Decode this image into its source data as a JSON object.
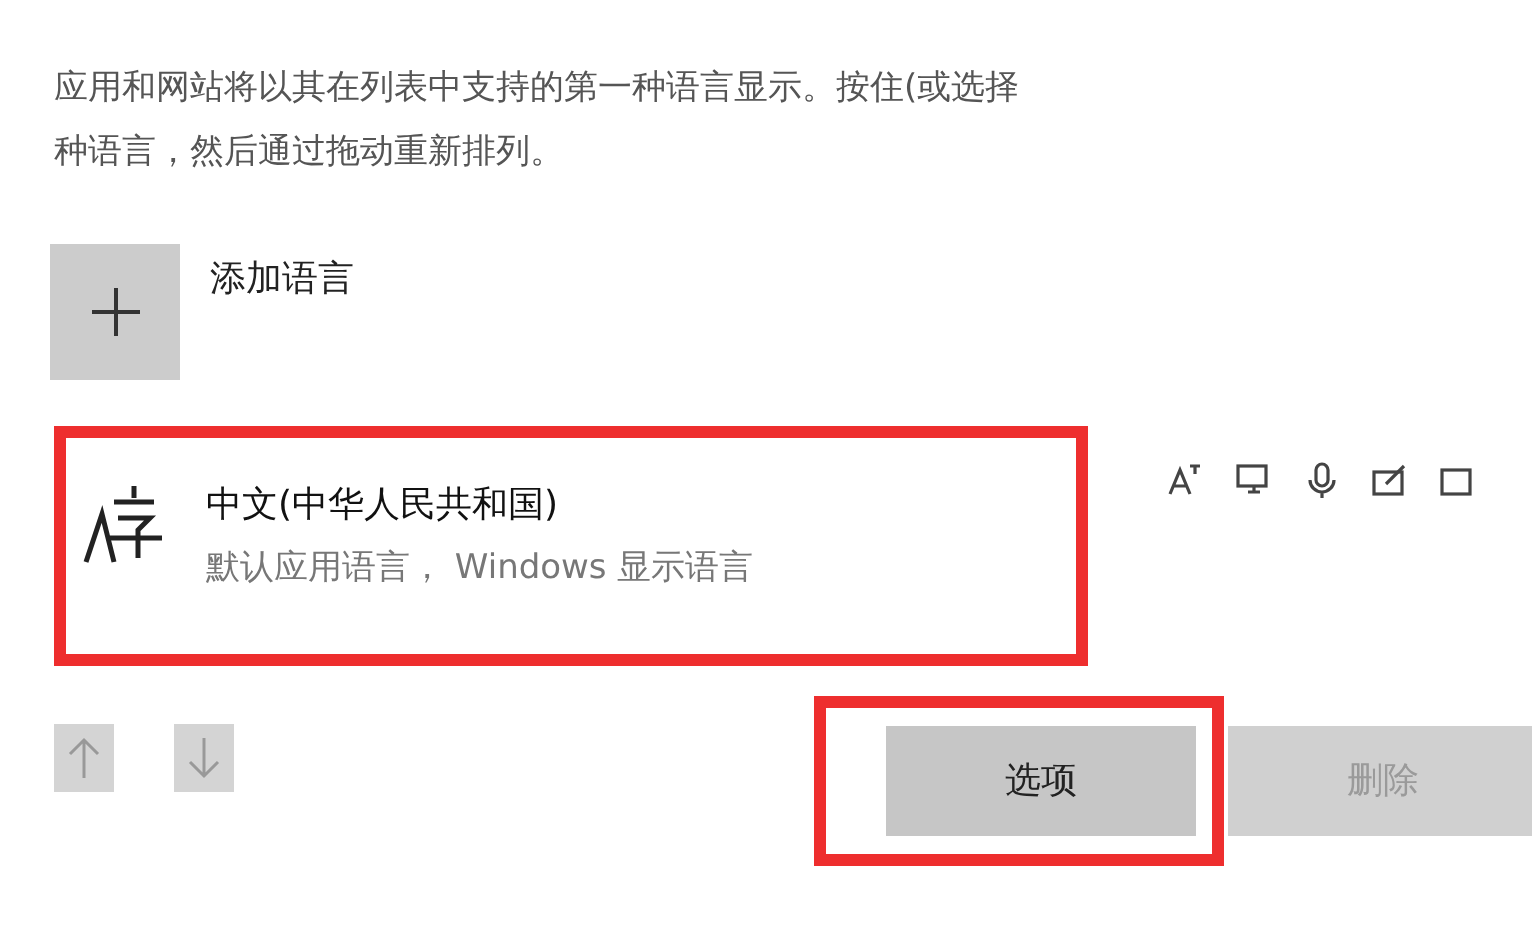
{
  "description_lines": [
    "应用和网站将以其在列表中支持的第一种语言显示。按住(或选择",
    "种语言，然后通过拖动重新排列。"
  ],
  "add_language": {
    "label": "添加语言"
  },
  "languages": [
    {
      "name": "中文(中华人民共和国)",
      "detail": "默认应用语言， Windows 显示语言",
      "highlighted": true
    }
  ],
  "move_buttons": [
    {
      "kind": "up",
      "disabled": true
    },
    {
      "kind": "down",
      "disabled": true
    }
  ],
  "actions": [
    {
      "label": "选项",
      "disabled": false,
      "highlighted": true
    },
    {
      "label": "删除",
      "disabled": true,
      "highlighted": false
    }
  ]
}
